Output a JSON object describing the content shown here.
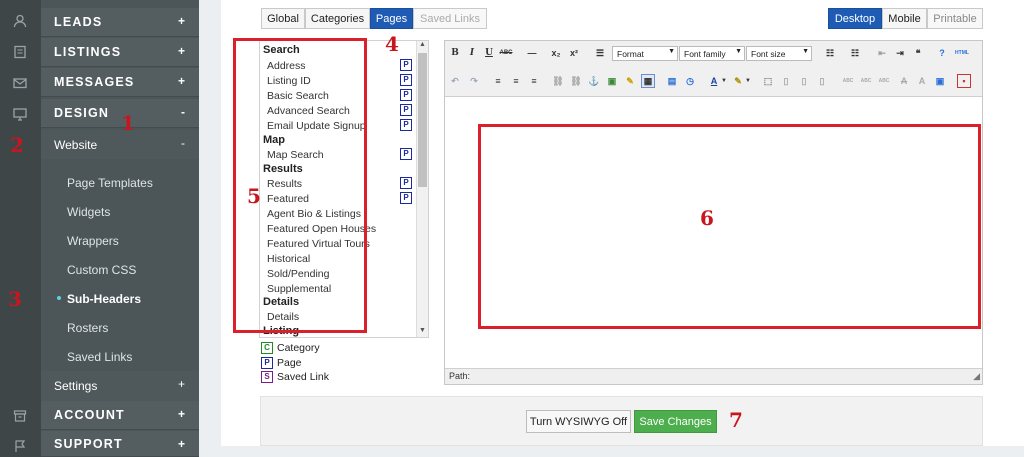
{
  "sidebar": {
    "sections": {
      "leads": "LEADS",
      "listings": "LISTINGS",
      "messages": "MESSAGES",
      "design": "DESIGN",
      "account": "ACCOUNT",
      "support": "SUPPORT"
    },
    "expand_plus": "+",
    "collapse_minus": "-",
    "website": "Website",
    "settings": "Settings",
    "items": [
      "Page Templates",
      "Widgets",
      "Wrappers",
      "Custom CSS",
      "Sub-Headers",
      "Rosters",
      "Saved Links"
    ],
    "active_item": "Sub-Headers",
    "rail_icons": [
      "user-icon",
      "book-icon",
      "envelope-icon",
      "monitor-icon",
      "archive-icon",
      "flag-icon"
    ]
  },
  "scope_tabs": [
    "Global",
    "Categories",
    "Pages",
    "Saved Links"
  ],
  "scope_active": "Pages",
  "view_tabs": [
    "Desktop",
    "Mobile",
    "Printable"
  ],
  "view_active": "Desktop",
  "tree": {
    "groups": [
      {
        "title": "Search",
        "items": [
          "Address",
          "Listing ID",
          "Basic Search",
          "Advanced Search",
          "Email Update Signup"
        ]
      },
      {
        "title": "Map",
        "items": [
          "Map Search"
        ]
      },
      {
        "title": "Results",
        "items": [
          "Results",
          "Featured",
          "Agent Bio & Listings",
          "Featured Open Houses",
          "Featured Virtual Tours",
          "Historical",
          "Sold/Pending",
          "Supplemental"
        ]
      },
      {
        "title": "Details",
        "items": [
          "Details"
        ]
      },
      {
        "title": "Listing",
        "items": []
      }
    ],
    "page_badge": "P"
  },
  "legend": [
    {
      "badge": "C",
      "label": "Category",
      "color": "#1f8a1f"
    },
    {
      "badge": "P",
      "label": "Page",
      "color": "#1c2a9c"
    },
    {
      "badge": "S",
      "label": "Saved Link",
      "color": "#7a1c8a"
    }
  ],
  "editor": {
    "format_label": "Format",
    "font_family_label": "Font family",
    "font_size_label": "Font size",
    "path_label": "Path:"
  },
  "buttons": {
    "wysiwyg_off": "Turn WYSIWYG Off",
    "save_changes": "Save Changes"
  },
  "annotations": [
    "1",
    "2",
    "3",
    "4",
    "5",
    "6",
    "7"
  ],
  "colors": {
    "accent_blue": "#1e5bb5",
    "save_green": "#4cae4c",
    "annotation_red": "#d9202b",
    "active_dot": "#5fd2da"
  }
}
